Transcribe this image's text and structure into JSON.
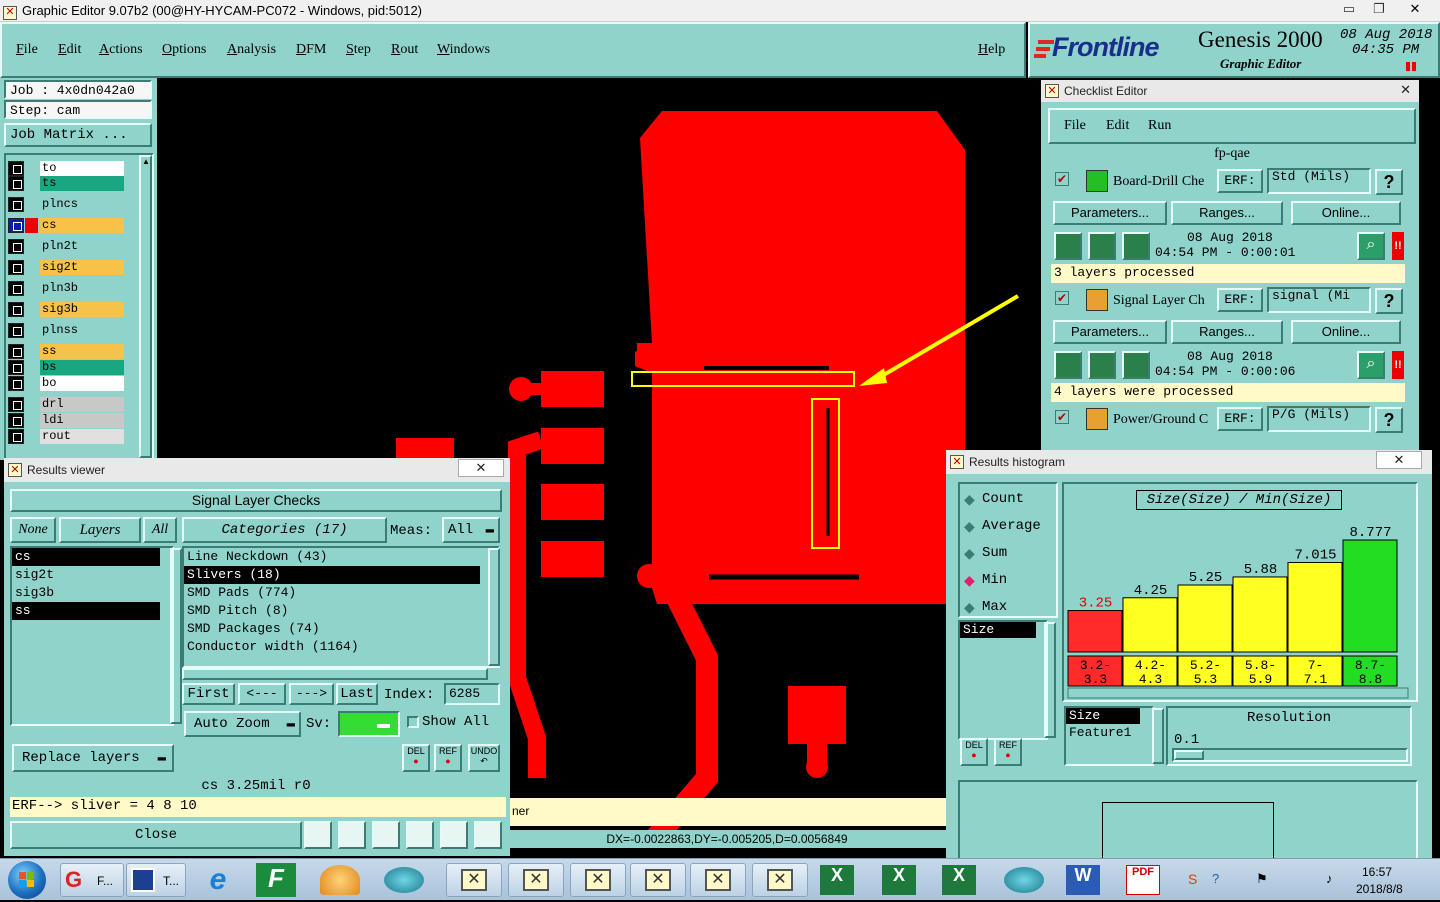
{
  "window": {
    "title": "Graphic Editor 9.07b2 (00@HY-HYCAM-PC072 - Windows, pid:5012)"
  },
  "menu": [
    "File",
    "Edit",
    "Actions",
    "Options",
    "Analysis",
    "DFM",
    "Step",
    "Rout",
    "Windows"
  ],
  "help": "Help",
  "brand": {
    "logo": "Frontline",
    "product": "Genesis 2000",
    "subtitle": "Graphic Editor",
    "date": "08 Aug 2018",
    "time": "04:35 PM"
  },
  "left": {
    "job": "Job : 4x0dn042a0",
    "step": "Step: cam",
    "job_matrix": "Job Matrix ...",
    "layers": [
      {
        "name": "to",
        "color": "#ffffff"
      },
      {
        "name": "ts",
        "color": "#1aa67e"
      },
      {
        "name": "plncs",
        "color": "#8fd3cb"
      },
      {
        "name": "cs",
        "color": "#f7c24a"
      },
      {
        "name": "pln2t",
        "color": "#8fd3cb"
      },
      {
        "name": "sig2t",
        "color": "#f7c24a"
      },
      {
        "name": "pln3b",
        "color": "#8fd3cb"
      },
      {
        "name": "sig3b",
        "color": "#f7c24a"
      },
      {
        "name": "plnss",
        "color": "#8fd3cb"
      },
      {
        "name": "ss",
        "color": "#f7c24a"
      },
      {
        "name": "bs",
        "color": "#1aa67e"
      },
      {
        "name": "bo",
        "color": "#ffffff"
      },
      {
        "name": "drl",
        "color": "#c8c8c8"
      },
      {
        "name": "ldi",
        "color": "#c8c8c8"
      },
      {
        "name": "rout",
        "color": "#e0e0e0"
      }
    ]
  },
  "checklist": {
    "title": "Checklist Editor",
    "menu": [
      "File",
      "Edit",
      "Run"
    ],
    "name": "fp-qae",
    "items": [
      {
        "title": "Board-Drill Che",
        "erf": "ERF:",
        "value": "Std (Mils)",
        "date": "08 Aug 2018",
        "time": "04:54 PM - 0:00:01",
        "status": "3 layers processed"
      },
      {
        "title": "Signal Layer Ch",
        "erf": "ERF:",
        "value": "signal (Mi",
        "date": "08 Aug 2018",
        "time": "04:54 PM - 0:00:06",
        "status": "4 layers were processed"
      },
      {
        "title": "Power/Ground C",
        "erf": "ERF:",
        "value": "P/G (Mils)"
      }
    ],
    "buttons": [
      "Parameters...",
      "Ranges...",
      "Online..."
    ],
    "help": "?"
  },
  "viewer": {
    "title": "Results viewer",
    "header": "Signal Layer Checks",
    "none": "None",
    "layers_label": "Layers",
    "all": "All",
    "categories_label": "Categories (17)",
    "meas_label": "Meas:",
    "meas_value": "All",
    "layers": [
      "cs",
      "sig2t",
      "sig3b",
      "ss"
    ],
    "categories": [
      "Line Neckdown (43)",
      "Slivers (18)",
      "SMD Pads (774)",
      "SMD Pitch (8)",
      "SMD Packages (74)",
      "Conductor width (1164)"
    ],
    "first": "First",
    "prev": "<---",
    "next": "--->",
    "last": "Last",
    "index_label": "Index:",
    "index_value": "6285",
    "auto_zoom": "Auto Zoom",
    "sv_label": "Sv:",
    "show_all": "Show All",
    "replace_layers": "Replace layers",
    "del": "DEL",
    "ref": "REF",
    "undo": "UNDO",
    "status": "cs 3.25mil  r0",
    "erf_line": "ERF--> sliver = 4 8 10",
    "close": "Close"
  },
  "histogram": {
    "title": "Results histogram",
    "stats": [
      "Count",
      "Average",
      "Sum",
      "Min",
      "Max"
    ],
    "selected_stat": "Min",
    "size_item": "Size",
    "chart_title": "Size(Size) / Min(Size)",
    "resolution_label": "Resolution",
    "resolution_value": "0.1",
    "list_items": [
      "Size",
      "Feature1"
    ],
    "del": "DEL",
    "ref": "REF"
  },
  "chart_data": {
    "type": "bar",
    "title": "Size(Size) / Min(Size)",
    "categories": [
      "3.2-3.3",
      "4.2-4.3",
      "5.2-5.3",
      "5.8-5.9",
      "7-7.1",
      "8.7-8.8"
    ],
    "values": [
      3.25,
      4.25,
      5.25,
      5.88,
      7.015,
      8.777
    ],
    "labels": [
      "3.25",
      "4.25",
      "5.25",
      "5.88",
      "7.015",
      "8.777"
    ],
    "bin_labels": [
      [
        "3.2-",
        "3.3"
      ],
      [
        "4.2-",
        "4.3"
      ],
      [
        "5.2-",
        "5.3"
      ],
      [
        "5.8-",
        "5.9"
      ],
      [
        "7-",
        "7.1"
      ],
      [
        "8.7-",
        "8.8"
      ]
    ],
    "colors": [
      "#ff2a2a",
      "#ffff22",
      "#ffff22",
      "#ffff22",
      "#ffff22",
      "#22dd22"
    ],
    "label_colors": [
      "#e00000",
      "#000000",
      "#000000",
      "#000000",
      "#000000",
      "#000000"
    ]
  },
  "canvas": {
    "coord_readout": "DX=-0.0022863,DY=-0.005205,D=0.0056849",
    "partial_text": "ner"
  },
  "taskbar": {
    "clock_time": "16:57",
    "clock_date": "2018/8/8",
    "app1": "F...",
    "app2": "T..."
  }
}
